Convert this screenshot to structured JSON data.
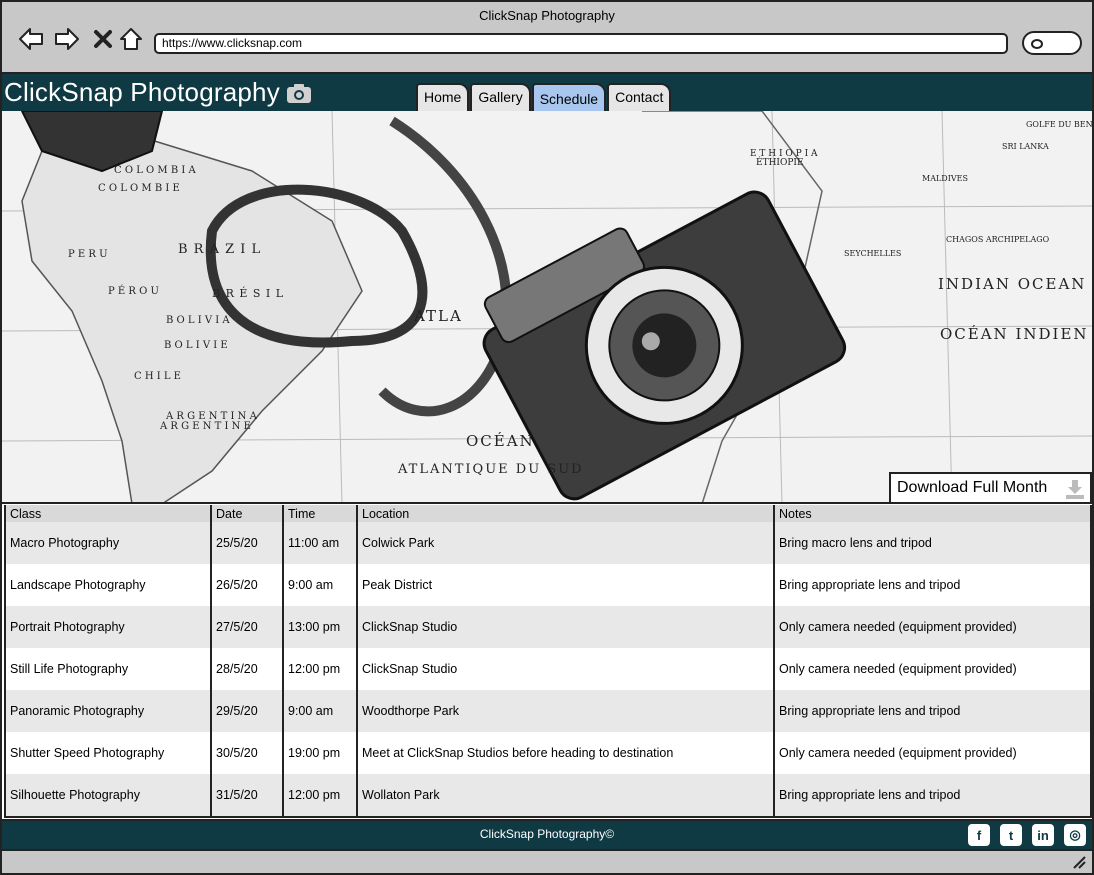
{
  "window": {
    "title": "ClickSnap Photography"
  },
  "browser": {
    "url": "https://www.clicksnap.com",
    "nav": [
      "back-icon",
      "forward-icon",
      "close-icon",
      "home-icon"
    ]
  },
  "site": {
    "brand": "ClickSnap Photography",
    "tabs": [
      {
        "label": "Home",
        "active": false
      },
      {
        "label": "Gallery",
        "active": false
      },
      {
        "label": "Schedule",
        "active": true
      },
      {
        "label": "Contact",
        "active": false
      }
    ],
    "accent_color": "#0f3a44",
    "active_tab_color": "#a9c7ee"
  },
  "hero": {
    "download_label": "Download Full Month",
    "map_labels": [
      "INDIAN OCEAN",
      "OCÉAN INDIEN",
      "OCÉAN",
      "ATLANTIQUE DU SUD",
      "B R A Z I L",
      "B R É S I L",
      "P E R U",
      "P É R O U",
      "B O L I V I A",
      "B O L I V I E",
      "A R G E N T I N A",
      "A R G E N T I N E",
      "C H I L E",
      "C O L O M B I A",
      "C O L O M B I E",
      "E T H I O P I A",
      "ÉTHIOPIE",
      "SEYCHELLES",
      "CHAGOS ARCHIPELAGO",
      "MALDIVES",
      "SRI LANKA",
      "GOLFE DU BENGALE",
      "ATLA"
    ]
  },
  "table": {
    "headers": [
      "Class",
      "Date",
      "Time",
      "Location",
      "Notes"
    ],
    "rows": [
      [
        "Macro Photography",
        "25/5/20",
        "11:00 am",
        "Colwick Park",
        "Bring macro lens and tripod"
      ],
      [
        "Landscape Photography",
        "26/5/20",
        "9:00 am",
        "Peak District",
        "Bring appropriate lens and tripod"
      ],
      [
        "Portrait Photography",
        "27/5/20",
        "13:00 pm",
        "ClickSnap Studio",
        "Only camera needed (equipment provided)"
      ],
      [
        "Still Life Photography",
        "28/5/20",
        "12:00 pm",
        "ClickSnap Studio",
        "Only camera needed (equipment provided)"
      ],
      [
        "Panoramic Photography",
        "29/5/20",
        "9:00 am",
        "Woodthorpe Park",
        "Bring appropriate lens and tripod"
      ],
      [
        "Shutter Speed Photography",
        "30/5/20",
        "19:00 pm",
        "Meet at ClickSnap Studios before heading to destination",
        "Only camera needed (equipment provided)"
      ],
      [
        "Silhouette Photography",
        "31/5/20",
        "12:00 pm",
        "Wollaton Park",
        "Bring appropriate lens and tripod"
      ]
    ]
  },
  "footer": {
    "text": "ClickSnap Photography©",
    "socials": [
      {
        "name": "facebook-icon",
        "glyph": "f"
      },
      {
        "name": "twitter-icon",
        "glyph": "t"
      },
      {
        "name": "linkedin-icon",
        "glyph": "in"
      },
      {
        "name": "instagram-icon",
        "glyph": "◎"
      }
    ]
  }
}
